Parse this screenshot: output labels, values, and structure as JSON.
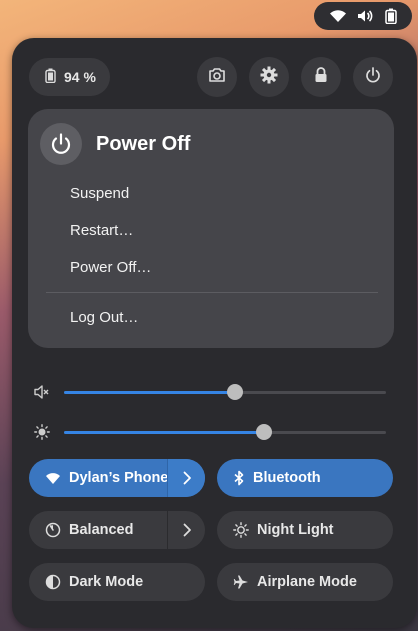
{
  "status_tray": {
    "icons": [
      "wifi-icon",
      "volume-icon",
      "battery-icon"
    ]
  },
  "quick_settings": {
    "battery_label": "94 %",
    "header_buttons": [
      "screenshot-icon",
      "settings-icon",
      "lock-icon",
      "power-icon"
    ],
    "power_menu": {
      "title": "Power Off",
      "items": [
        "Suspend",
        "Restart…",
        "Power Off…"
      ],
      "logout": "Log Out…"
    },
    "sliders": {
      "volume_level": 0.53,
      "brightness_level": 0.62
    },
    "toggles": [
      {
        "label": "Dylan’s Phone",
        "icon": "wifi-icon",
        "active": true,
        "has_menu": true
      },
      {
        "label": "Bluetooth",
        "icon": "bluetooth-icon",
        "active": true,
        "has_menu": false
      },
      {
        "label": "Balanced",
        "icon": "power-profile-icon",
        "active": false,
        "has_menu": true
      },
      {
        "label": "Night Light",
        "icon": "night-light-icon",
        "active": false,
        "has_menu": false
      },
      {
        "label": "Dark Mode",
        "icon": "dark-mode-icon",
        "active": false,
        "has_menu": false
      },
      {
        "label": "Airplane Mode",
        "icon": "airplane-icon",
        "active": false,
        "has_menu": false
      }
    ]
  },
  "colors": {
    "accent": "#3584e4",
    "panel": "#2a2a2e",
    "submenu": "#45454a"
  }
}
